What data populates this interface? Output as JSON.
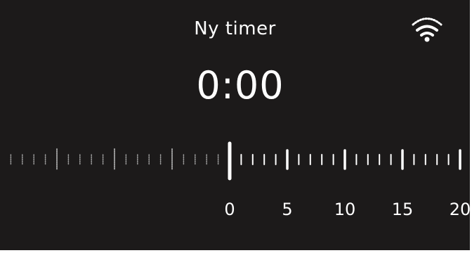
{
  "timer": {
    "title": "Ny timer",
    "time": "0:00"
  },
  "status": {
    "wifi_icon": "wifi-icon"
  },
  "ruler": {
    "labels": [
      "0",
      "5",
      "10",
      "15",
      "20"
    ],
    "selected_value": 0,
    "unit_per_major": 5
  },
  "colors": {
    "background": "#1c1a1a",
    "foreground": "#ffffff",
    "dim": "#9a9a9a"
  }
}
